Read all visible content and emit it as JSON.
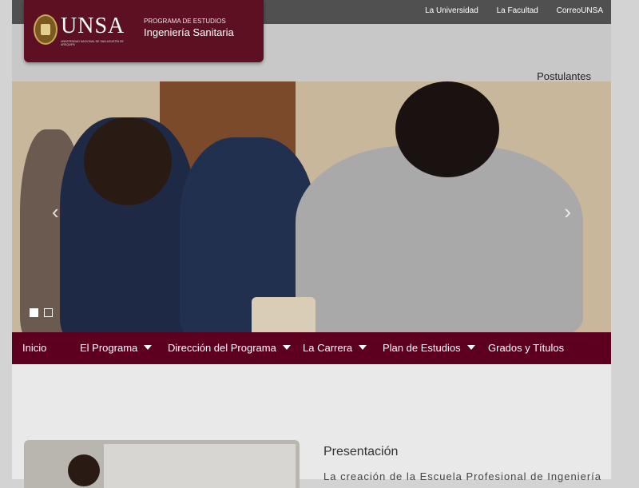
{
  "top_links": [
    "La Universidad",
    "La Facultad",
    "CorreoUNSA"
  ],
  "logo": {
    "main": "UNSA",
    "sub": "UNIVERSIDAD NACIONAL DE SAN AGUSTÍN DE AREQUIPA",
    "program_small": "PROGRAMA DE ESTUDIOS",
    "program_big": "Ingeniería Sanitaria"
  },
  "header": {
    "postulantes": "Postulantes"
  },
  "slider": {
    "slides": 2,
    "active": 1
  },
  "nav": [
    {
      "label": "Inicio",
      "dropdown": false
    },
    {
      "label": "El Programa",
      "dropdown": true
    },
    {
      "label": "Dirección del Programa",
      "dropdown": true
    },
    {
      "label": "La Carrera",
      "dropdown": true
    },
    {
      "label": "Plan de Estudios",
      "dropdown": true
    },
    {
      "label": "Grados y Títulos",
      "dropdown": false
    }
  ],
  "presentation": {
    "title": "Presentación",
    "text": "La creación de la Escuela Profesional de Ingeniería"
  },
  "colors": {
    "brand": "#5d0020",
    "topbar": "#505050"
  }
}
